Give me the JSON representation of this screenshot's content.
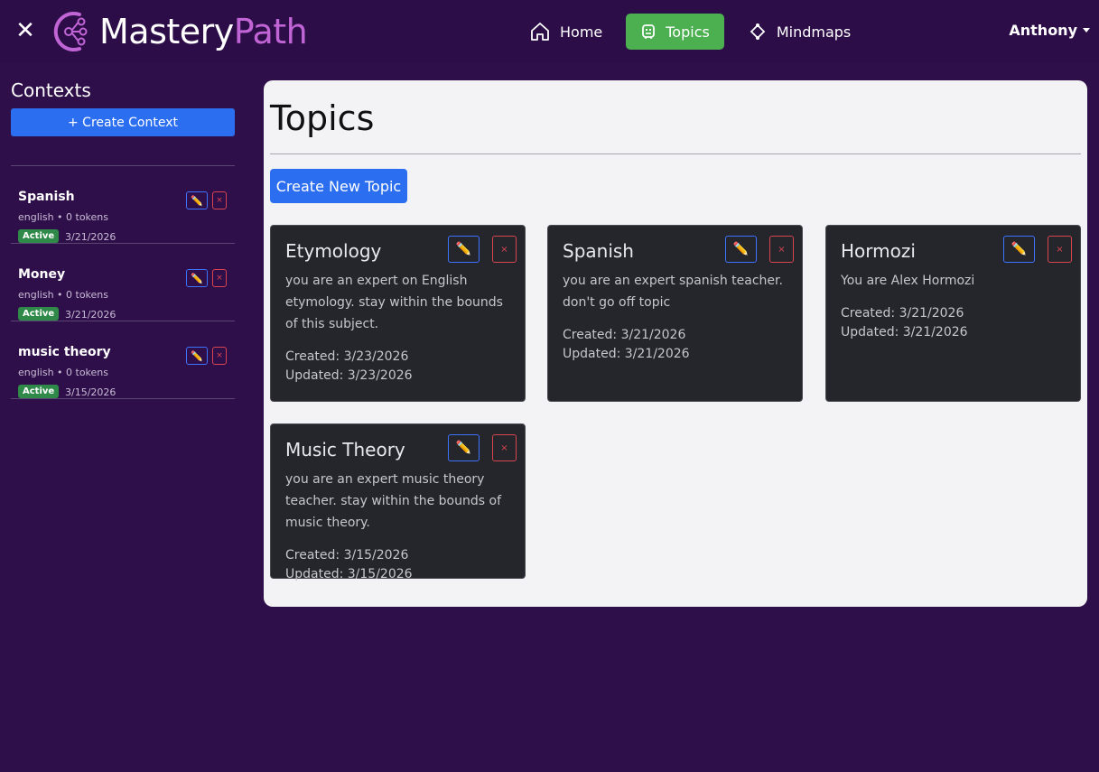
{
  "app": {
    "brand_part1": "Mastery",
    "brand_part2": "Path",
    "close_glyph": "✕"
  },
  "nav": {
    "items": [
      {
        "label": "Home",
        "icon": "home-icon"
      },
      {
        "label": "Topics",
        "icon": "robot-icon",
        "active": true
      },
      {
        "label": "Mindmaps",
        "icon": "diamond-node-icon"
      }
    ]
  },
  "user": {
    "name": "Anthony"
  },
  "sidebar": {
    "title": "Contexts",
    "create_label": "+ Create Context",
    "contexts": [
      {
        "name": "Spanish",
        "meta": "english • 0 tokens",
        "status": "Active",
        "date": "3/21/2026"
      },
      {
        "name": "Money",
        "meta": "english • 0 tokens",
        "status": "Active",
        "date": "3/21/2026"
      },
      {
        "name": "music theory",
        "meta": "english • 0 tokens",
        "status": "Active",
        "date": "3/15/2026"
      }
    ],
    "edit_glyph": "✏️",
    "delete_glyph": "×"
  },
  "main": {
    "title": "Topics",
    "create_label": "Create New Topic",
    "topics": [
      {
        "title": "Etymology",
        "description": "you are an expert on English etymology. stay within the bounds of this subject.",
        "created": "Created: 3/23/2026",
        "updated": "Updated: 3/23/2026"
      },
      {
        "title": "Spanish",
        "description": "you are an expert spanish teacher. don't go off topic",
        "created": "Created: 3/21/2026",
        "updated": "Updated: 3/21/2026"
      },
      {
        "title": "Hormozi",
        "description": "You are Alex Hormozi",
        "created": "Created: 3/21/2026",
        "updated": "Updated: 3/21/2026"
      },
      {
        "title": "Music Theory",
        "description": "you are an expert music theory teacher. stay within the bounds of music theory.",
        "created": "Created: 3/15/2026",
        "updated": "Updated: 3/15/2026"
      }
    ]
  },
  "colors": {
    "background": "#2e0f49",
    "accent_blue": "#2b6ff0",
    "active_green": "#4caf50",
    "brand_purple": "#c064d6",
    "danger": "#d9454e"
  }
}
